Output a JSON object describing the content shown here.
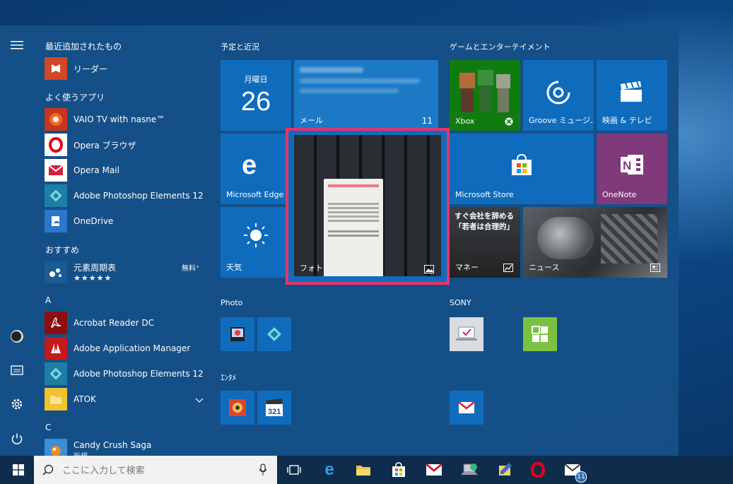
{
  "applist": {
    "recent_header": "最近追加されたもの",
    "recent_items": [
      {
        "label": "リーダー"
      }
    ],
    "frequent_header": "よく使うアプリ",
    "frequent_items": [
      {
        "label": "VAIO TV with nasne™"
      },
      {
        "label": "Opera ブラウザ"
      },
      {
        "label": "Opera  Mail"
      },
      {
        "label": "Adobe Photoshop Elements 12"
      },
      {
        "label": "OneDrive"
      }
    ],
    "suggested_header": "おすすめ",
    "suggested_item": {
      "label": "元素周期表",
      "badge": "無料⁺",
      "stars": "★★★★★"
    },
    "letter_a": "A",
    "a_items": [
      {
        "label": "Acrobat Reader DC"
      },
      {
        "label": "Adobe Application Manager"
      },
      {
        "label": "Adobe Photoshop Elements 12"
      },
      {
        "label": "ATOK"
      }
    ],
    "letter_c": "C",
    "c_item": {
      "label": "Candy Crush Saga",
      "sub": "新規"
    }
  },
  "groups": {
    "schedule": "予定と近況",
    "games": "ゲームとエンターテイメント",
    "photo": "Photo",
    "sony": "SONY",
    "entame": "ｴﾝﾀﾒ"
  },
  "tiles": {
    "calendar": {
      "day": "月曜日",
      "date": "26"
    },
    "mail": {
      "label": "メール",
      "count": "11"
    },
    "edge": {
      "label": "Microsoft Edge"
    },
    "photos": {
      "label": "フォト"
    },
    "weather": {
      "label": "天気"
    },
    "xbox": {
      "label": "Xbox"
    },
    "groove": {
      "label": "Groove ミュージ..."
    },
    "movies": {
      "label": "映画 & テレビ"
    },
    "store": {
      "label": "Microsoft Store"
    },
    "onenote": {
      "label": "OneNote"
    },
    "money": {
      "label": "マネー",
      "headline": "すぐ会社を辞める「若者は合理的」"
    },
    "news": {
      "label": "ニュース"
    }
  },
  "taskbar": {
    "search_placeholder": "ここに入力して検索",
    "mail_badge": "11"
  },
  "colors": {
    "accent": "#0f6cbd",
    "highlight": "#e8336b",
    "onenote": "#80397b",
    "xbox": "#107c10"
  }
}
